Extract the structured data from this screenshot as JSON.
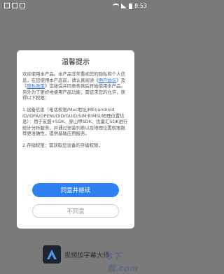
{
  "status_bar": {
    "time": "8:53"
  },
  "background_app": {
    "app_name": "视频加字幕大师",
    "watermark": "8下载.com"
  },
  "dialog": {
    "title": "温馨提示",
    "para1_text_1": "欢迎使用本产品。本产品非常重视您的隐私和个人信息，在您使用本产品前，请认真阅读《",
    "user_agreement_link": "用户协议",
    "para1_text_2": "》及《",
    "privacy_policy_link": "隐私政策",
    "para1_text_3": "》您接受并同意条款后开始使用本产品。另外为了更好地使用产品功能，需征求您的允许，获得以下权限：",
    "para2_text": "1.设备信息（电话权限/Mac地址/MEI/android ID/IDFA/OPENUDID/GUID/SIM卡IMSI/地理位置信息）：用于友盟+SDK、穿山甲SDK、优量汇SDK进行统计分析服务，并通过安装列表以及地理位置权限推荐更准确性，提供基础应用服务。",
    "para3_text": "2.存储权限：需获取您设备的存储权限，",
    "agree_label": "同意并继续",
    "disagree_label": "不同意"
  },
  "colors": {
    "accent": "#2f7ff0",
    "link": "#2f6fd6",
    "overlay": "#7a7a7a"
  }
}
